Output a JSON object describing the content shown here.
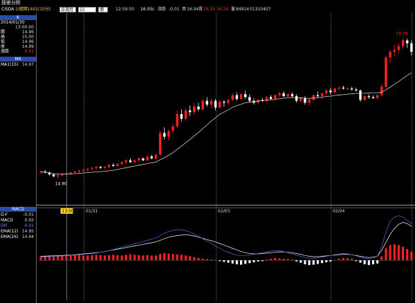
{
  "app": {
    "title": "技術分析"
  },
  "toolbar": {
    "ticker": "CISDA",
    "name": "1I號期1401(15分)",
    "period_label": "日週月",
    "interval": "15",
    "chart_mode": "價量",
    "time": "12:59:50",
    "last_price": "16.05c",
    "change_label": "漲跌",
    "change": "-0.01",
    "buy_label": "買",
    "buy": "16.04",
    "sell_label": "賣",
    "sell": "16.25",
    "sell2": "16.24",
    "volume_label": "量",
    "volume": "84914",
    "extra": "01310407"
  },
  "sidebar": {
    "k_header": "K",
    "date": "2014/01/30",
    "time": "13:00:00",
    "rows": [
      {
        "label": "開",
        "value": "14.96"
      },
      {
        "label": "高",
        "value": "15.00"
      },
      {
        "label": "低",
        "value": "14.96"
      },
      {
        "label": "收",
        "value": "14.99"
      },
      {
        "label": "漲跌",
        "value": "0.01"
      }
    ],
    "ma_header": "MA",
    "ma_row": {
      "label": "MA1(15)",
      "value": "14.97"
    },
    "macd_header": "MACD",
    "macd_rows": [
      {
        "label": "D-F",
        "value": "-0.01"
      },
      {
        "label": "MACD",
        "value": "0.02"
      },
      {
        "label": "DIF",
        "value": "0.01"
      },
      {
        "label": "EMA(12)",
        "value": "14.95"
      },
      {
        "label": "EMA(26)",
        "value": "14.94"
      }
    ]
  },
  "chart_data": {
    "type": "candlestick",
    "x_ticks": [
      "01/31",
      "02/03",
      "02/04"
    ],
    "annotations": {
      "low": "14.90",
      "high": "16.38"
    },
    "crosshair_time": "13:00",
    "colors": {
      "up": "#ff2020",
      "down": "#ffffff",
      "ma": "#cfcfcf",
      "macd": "#ffffff",
      "dif": "#4a6cd8",
      "grid": "#7fa0b8",
      "separator": "#7fa0b8"
    },
    "ylim": [
      14.78,
      16.62
    ],
    "ma_period": 15,
    "candles": [
      [
        14.96,
        14.98,
        14.95,
        14.97
      ],
      [
        14.97,
        14.99,
        14.95,
        14.96
      ],
      [
        14.96,
        14.97,
        14.93,
        14.94
      ],
      [
        14.94,
        14.95,
        14.91,
        14.92
      ],
      [
        14.92,
        14.94,
        14.9,
        14.93
      ],
      [
        14.93,
        14.95,
        14.92,
        14.94
      ],
      [
        14.94,
        14.96,
        14.93,
        14.95
      ],
      [
        14.95,
        14.97,
        14.94,
        14.96
      ],
      [
        14.96,
        14.98,
        14.95,
        14.97
      ],
      [
        14.97,
        14.99,
        14.95,
        14.98
      ],
      [
        14.98,
        15.0,
        14.96,
        14.99
      ],
      [
        14.99,
        15.01,
        14.97,
        15.0
      ],
      [
        15.0,
        15.02,
        14.98,
        15.01
      ],
      [
        15.01,
        15.03,
        14.99,
        15.02
      ],
      [
        15.02,
        15.03,
        15.0,
        15.01
      ],
      [
        15.01,
        15.03,
        15.0,
        15.02
      ],
      [
        15.02,
        15.05,
        15.01,
        15.04
      ],
      [
        15.04,
        15.06,
        15.02,
        15.03
      ],
      [
        15.03,
        15.06,
        15.02,
        15.05
      ],
      [
        15.05,
        15.08,
        15.04,
        15.07
      ],
      [
        15.07,
        15.1,
        15.05,
        15.09
      ],
      [
        15.09,
        15.11,
        15.06,
        15.07
      ],
      [
        15.07,
        15.1,
        15.06,
        15.09
      ],
      [
        15.09,
        15.12,
        15.07,
        15.11
      ],
      [
        15.11,
        15.12,
        15.08,
        15.09
      ],
      [
        15.09,
        15.14,
        15.08,
        15.13
      ],
      [
        15.13,
        15.15,
        15.1,
        15.11
      ],
      [
        15.11,
        15.16,
        15.1,
        15.15
      ],
      [
        15.15,
        15.4,
        15.14,
        15.38
      ],
      [
        15.38,
        15.44,
        15.31,
        15.34
      ],
      [
        15.34,
        15.42,
        15.3,
        15.4
      ],
      [
        15.4,
        15.48,
        15.37,
        15.45
      ],
      [
        15.45,
        15.62,
        15.43,
        15.58
      ],
      [
        15.58,
        15.63,
        15.5,
        15.53
      ],
      [
        15.53,
        15.64,
        15.51,
        15.62
      ],
      [
        15.62,
        15.67,
        15.56,
        15.6
      ],
      [
        15.6,
        15.7,
        15.57,
        15.66
      ],
      [
        15.66,
        15.7,
        15.61,
        15.63
      ],
      [
        15.63,
        15.74,
        15.62,
        15.72
      ],
      [
        15.72,
        15.76,
        15.66,
        15.68
      ],
      [
        15.68,
        15.74,
        15.64,
        15.72
      ],
      [
        15.72,
        15.74,
        15.62,
        15.65
      ],
      [
        15.65,
        15.73,
        15.64,
        15.71
      ],
      [
        15.71,
        15.73,
        15.66,
        15.7
      ],
      [
        15.7,
        15.74,
        15.68,
        15.73
      ],
      [
        15.73,
        15.8,
        15.72,
        15.78
      ],
      [
        15.78,
        15.81,
        15.72,
        15.74
      ],
      [
        15.74,
        15.8,
        15.73,
        15.79
      ],
      [
        15.79,
        15.83,
        15.74,
        15.76
      ],
      [
        15.76,
        15.79,
        15.7,
        15.72
      ],
      [
        15.72,
        15.75,
        15.68,
        15.7
      ],
      [
        15.7,
        15.74,
        15.69,
        15.73
      ],
      [
        15.73,
        15.75,
        15.71,
        15.72
      ],
      [
        15.72,
        15.77,
        15.71,
        15.76
      ],
      [
        15.76,
        15.78,
        15.73,
        15.74
      ],
      [
        15.74,
        15.79,
        15.73,
        15.78
      ],
      [
        15.78,
        15.82,
        15.76,
        15.8
      ],
      [
        15.8,
        15.82,
        15.76,
        15.77
      ],
      [
        15.77,
        15.8,
        15.75,
        15.79
      ],
      [
        15.79,
        15.81,
        15.76,
        15.77
      ],
      [
        15.77,
        15.79,
        15.7,
        15.72
      ],
      [
        15.72,
        15.76,
        15.7,
        15.75
      ],
      [
        15.75,
        15.77,
        15.68,
        15.7
      ],
      [
        15.7,
        15.74,
        15.67,
        15.73
      ],
      [
        15.73,
        15.79,
        15.72,
        15.78
      ],
      [
        15.78,
        15.82,
        15.75,
        15.77
      ],
      [
        15.77,
        15.81,
        15.74,
        15.8
      ],
      [
        15.8,
        15.85,
        15.78,
        15.83
      ],
      [
        15.83,
        15.86,
        15.79,
        15.81
      ],
      [
        15.81,
        15.86,
        15.8,
        15.85
      ],
      [
        15.85,
        15.87,
        15.83,
        15.86
      ],
      [
        15.86,
        15.88,
        15.84,
        15.85
      ],
      [
        15.85,
        15.86,
        15.84,
        15.85
      ],
      [
        15.85,
        15.87,
        15.83,
        15.84
      ],
      [
        15.84,
        15.86,
        15.82,
        15.83
      ],
      [
        15.83,
        15.84,
        15.71,
        15.73
      ],
      [
        15.73,
        15.78,
        15.72,
        15.77
      ],
      [
        15.77,
        15.79,
        15.74,
        15.76
      ],
      [
        15.76,
        15.78,
        15.74,
        15.75
      ],
      [
        15.75,
        15.79,
        15.74,
        15.78
      ],
      [
        15.78,
        15.9,
        15.77,
        15.87
      ],
      [
        15.87,
        16.2,
        15.85,
        16.18
      ],
      [
        16.18,
        16.26,
        16.12,
        16.24
      ],
      [
        16.24,
        16.31,
        16.19,
        16.26
      ],
      [
        16.26,
        16.33,
        16.22,
        16.3
      ],
      [
        16.3,
        16.38,
        16.27,
        16.36
      ],
      [
        16.36,
        16.38,
        16.28,
        16.33
      ],
      [
        16.33,
        16.36,
        16.2,
        16.24
      ]
    ],
    "macd_ylim": [
      -0.1,
      0.12
    ],
    "macd_bars": [
      0.01,
      0.012,
      0.011,
      0.01,
      0.012,
      0.013,
      0.012,
      0.011,
      0.012,
      0.013,
      0.012,
      0.012,
      0.013,
      0.014,
      0.013,
      0.012,
      0.013,
      0.014,
      0.013,
      0.012,
      0.014,
      0.015,
      0.014,
      0.013,
      0.012,
      0.013,
      0.012,
      0.012,
      0.016,
      0.018,
      0.017,
      0.016,
      0.015,
      0.014,
      0.012,
      0.01,
      0.008,
      0.006,
      0.004,
      0.003,
      0.002,
      0.001,
      -0.002,
      -0.004,
      -0.006,
      -0.008,
      -0.01,
      -0.011,
      -0.009,
      -0.007,
      -0.005,
      -0.003,
      -0.002,
      0.002,
      0.004,
      0.006,
      0.005,
      0.004,
      0.003,
      0.002,
      -0.003,
      -0.006,
      -0.01,
      -0.012,
      -0.011,
      -0.009,
      -0.007,
      -0.005,
      -0.003,
      0.001,
      0.004,
      0.006,
      0.005,
      0.004,
      -0.002,
      -0.006,
      -0.01,
      -0.012,
      -0.01,
      -0.008,
      0.01,
      0.03,
      0.038,
      0.04,
      0.038,
      0.034,
      0.028,
      0.022
    ],
    "macd_line": [
      0.01,
      0.01,
      0.011,
      0.011,
      0.012,
      0.012,
      0.013,
      0.013,
      0.014,
      0.015,
      0.016,
      0.017,
      0.018,
      0.019,
      0.02,
      0.022,
      0.024,
      0.026,
      0.028,
      0.03,
      0.032,
      0.034,
      0.036,
      0.038,
      0.04,
      0.042,
      0.044,
      0.046,
      0.05,
      0.054,
      0.058,
      0.06,
      0.062,
      0.063,
      0.064,
      0.063,
      0.061,
      0.058,
      0.055,
      0.052,
      0.049,
      0.046,
      0.042,
      0.038,
      0.034,
      0.03,
      0.026,
      0.022,
      0.019,
      0.017,
      0.016,
      0.016,
      0.017,
      0.018,
      0.019,
      0.02,
      0.021,
      0.021,
      0.02,
      0.019,
      0.017,
      0.015,
      0.012,
      0.01,
      0.009,
      0.009,
      0.01,
      0.011,
      0.012,
      0.013,
      0.014,
      0.015,
      0.015,
      0.014,
      0.012,
      0.01,
      0.008,
      0.007,
      0.008,
      0.01,
      0.025,
      0.045,
      0.065,
      0.08,
      0.09,
      0.095,
      0.092,
      0.085
    ],
    "dif_line": [
      0.008,
      0.009,
      0.009,
      0.01,
      0.01,
      0.011,
      0.011,
      0.012,
      0.013,
      0.014,
      0.015,
      0.016,
      0.017,
      0.018,
      0.02,
      0.022,
      0.024,
      0.027,
      0.03,
      0.033,
      0.036,
      0.039,
      0.041,
      0.044,
      0.047,
      0.05,
      0.053,
      0.056,
      0.062,
      0.068,
      0.072,
      0.075,
      0.077,
      0.076,
      0.074,
      0.071,
      0.066,
      0.06,
      0.054,
      0.048,
      0.042,
      0.036,
      0.03,
      0.024,
      0.02,
      0.016,
      0.013,
      0.012,
      0.012,
      0.013,
      0.015,
      0.017,
      0.019,
      0.021,
      0.023,
      0.024,
      0.024,
      0.022,
      0.019,
      0.016,
      0.013,
      0.01,
      0.007,
      0.005,
      0.005,
      0.006,
      0.008,
      0.01,
      0.012,
      0.014,
      0.016,
      0.017,
      0.016,
      0.014,
      0.011,
      0.008,
      0.005,
      0.004,
      0.006,
      0.01,
      0.035,
      0.07,
      0.098,
      0.108,
      0.112,
      0.108,
      0.1,
      0.092
    ]
  }
}
